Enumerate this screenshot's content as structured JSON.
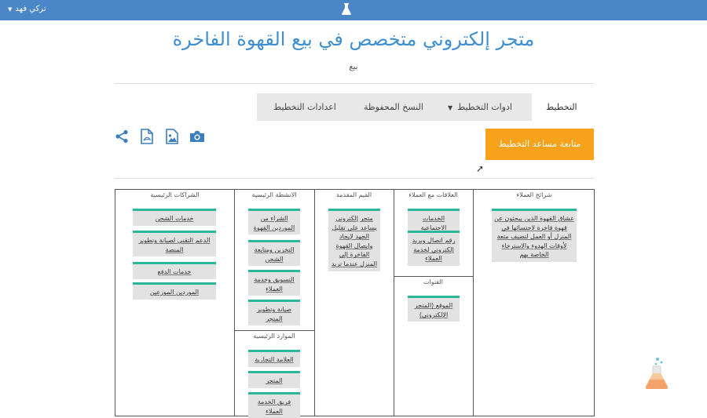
{
  "topbar": {
    "user_name": "تركي فهد"
  },
  "header": {
    "title": "متجر إلكتروني متخصص في بيع القهوة الفاخرة",
    "subtitle": "بيع"
  },
  "tabs": {
    "planning": "التخطيط",
    "tools": "ادوات التخطيط",
    "saved": "النسخ المحفوظة",
    "settings": "اعدادات التخطيط"
  },
  "actions": {
    "cta": "متابعة مساعد التخطيط"
  },
  "icons": [
    "share-icon",
    "pdf-icon",
    "image-icon",
    "camera-icon"
  ],
  "canvas": {
    "partners": {
      "title": "الشراكات الرئيسية",
      "notes": [
        "خدمات الشحن",
        "الدعم التقني لصيانة وتطوير المنصة",
        "خدمات الدفع",
        "الموردين الموزعين"
      ]
    },
    "activities": {
      "title": "الانشطة الرئيسية",
      "notes": [
        "الشراء من الموردين القهوة",
        "التخزين ومتابعة الشحن",
        "التسويق وخدمة العملاء",
        "صيانة وتطوير المتجر"
      ]
    },
    "resources": {
      "title": "الموارد الرئيسية",
      "notes": [
        "العلامة التجارية",
        "المتجر",
        "فريق الخدمة العملاء"
      ]
    },
    "value": {
      "title": "القيم المقدمة",
      "notes": [
        "متجر إلكتروني يساعد على تقليل الجهد لإيجاد وإيصال القهوة الفاخرة إلى المنزل عندما تريد"
      ]
    },
    "relationships": {
      "title": "العلاقات مع العملاء",
      "notes": [
        "الخدمات الاجتماعية",
        "رقم اتصال وبريد إلكتروني لخدمة العملاء"
      ]
    },
    "channels": {
      "title": "القنوات",
      "notes": [
        "الموقع (المتجر الإلكتروني)"
      ]
    },
    "segments": {
      "title": "شرائح العملاء",
      "notes": [
        "عشاق القهوة الذين يبحثون عن قهوة فاخرة لاحتسائها في المنزل أو العمل لتضيف متعة لأوقات الهدوء والاسترخاء الخاصة بهم"
      ]
    }
  },
  "colors": {
    "topbar": "#4a86c8",
    "title": "#3d8fd1",
    "cta": "#f7a21b",
    "note_accent": "#2bb89a"
  }
}
